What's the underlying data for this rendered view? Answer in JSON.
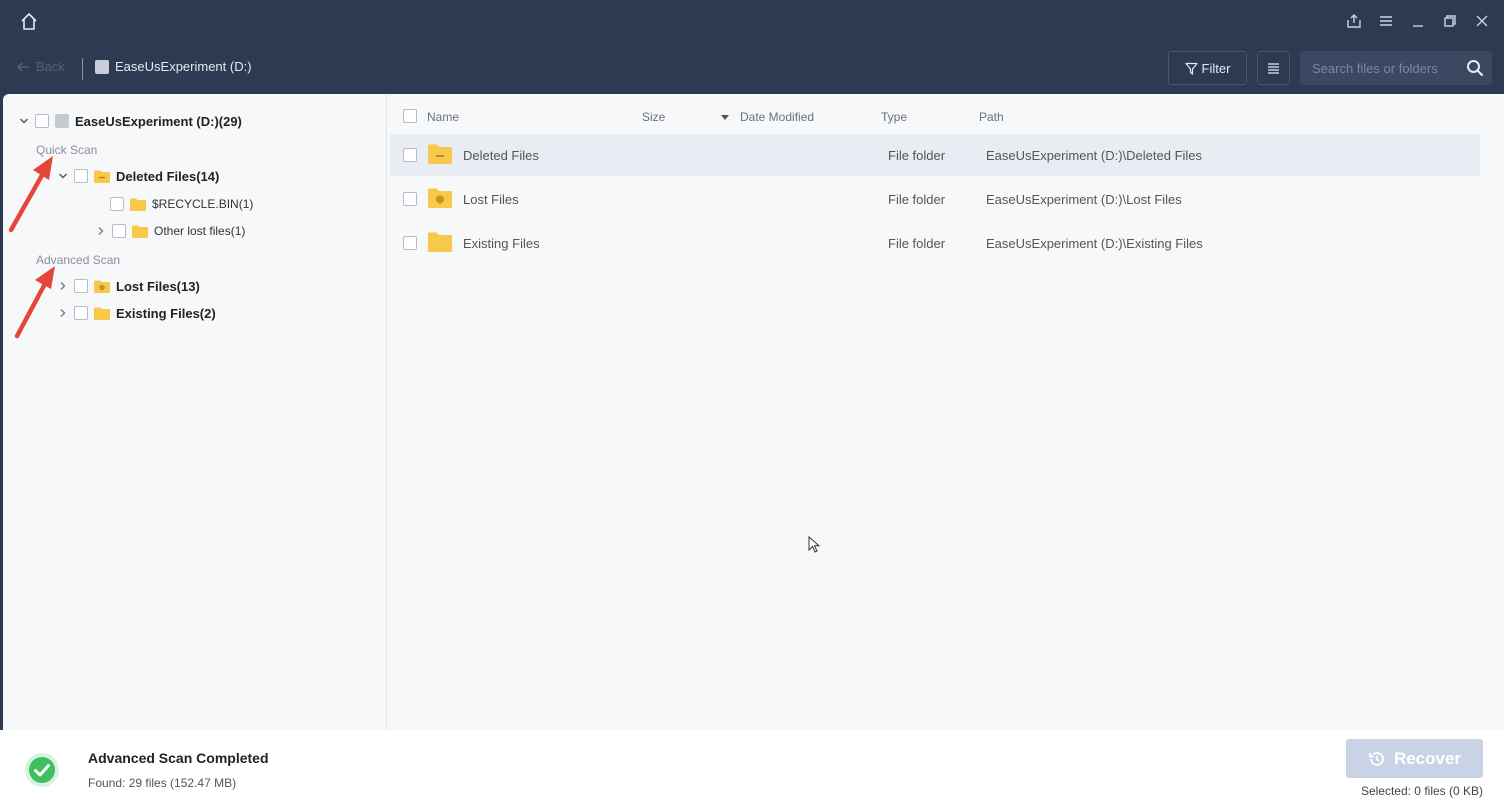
{
  "titlebar": {
    "icons": [
      "home-icon",
      "export-icon",
      "menu-icon",
      "minimize-icon",
      "restore-icon",
      "close-icon"
    ]
  },
  "nav": {
    "back_label": "Back",
    "breadcrumb": "EaseUsExperiment (D:)",
    "filter_label": "Filter",
    "search_placeholder": "Search files or folders"
  },
  "tree": {
    "root_label": "EaseUsExperiment (D:)(29)",
    "quick_scan_label": "Quick Scan",
    "advanced_scan_label": "Advanced Scan",
    "deleted_files": "Deleted Files(14)",
    "recycle_bin": "$RECYCLE.BIN(1)",
    "other_lost": "Other lost files(1)",
    "lost_files": "Lost Files(13)",
    "existing_files": "Existing Files(2)"
  },
  "list": {
    "columns": {
      "name": "Name",
      "size": "Size",
      "date": "Date Modified",
      "type": "Type",
      "path": "Path"
    },
    "rows": [
      {
        "name": "Deleted Files",
        "type": "File folder",
        "path": "EaseUsExperiment (D:)\\Deleted Files"
      },
      {
        "name": "Lost Files",
        "type": "File folder",
        "path": "EaseUsExperiment (D:)\\Lost Files"
      },
      {
        "name": "Existing Files",
        "type": "File folder",
        "path": "EaseUsExperiment (D:)\\Existing Files"
      }
    ]
  },
  "status": {
    "title": "Advanced Scan Completed",
    "found": "Found: 29 files (152.47 MB)",
    "recover_label": "Recover",
    "selected": "Selected: 0 files (0 KB)"
  },
  "colors": {
    "header_bg": "#2e3a52",
    "folder": "#f7c948",
    "success": "#3fbf5f",
    "arrow": "#e5453a",
    "recover_disabled": "#c8d3e6"
  }
}
